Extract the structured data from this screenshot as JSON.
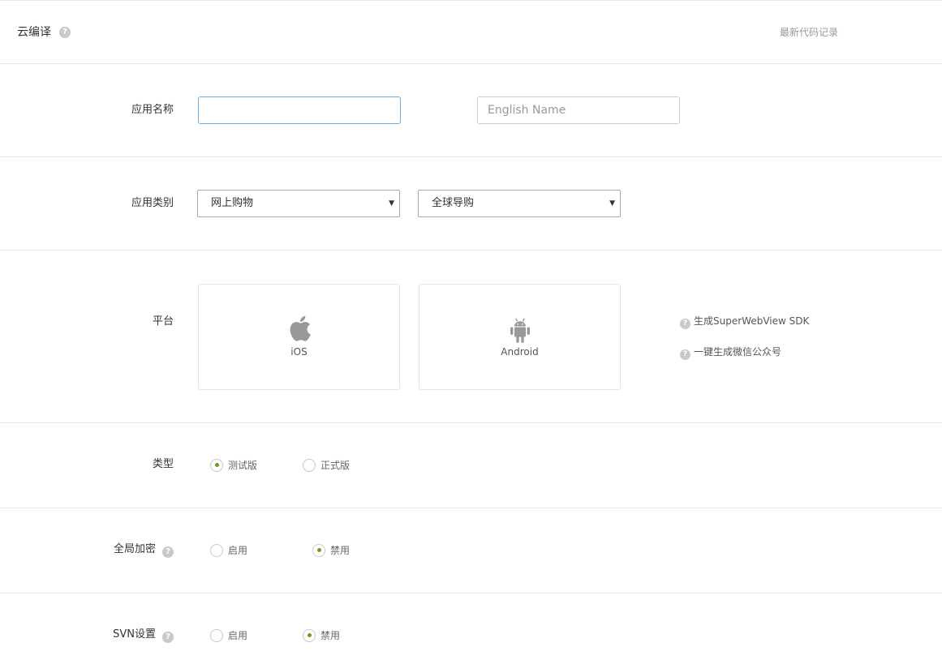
{
  "header": {
    "title": "云编译",
    "help_icon": "question-circle-icon",
    "record_link": "最新代码记录"
  },
  "app_name": {
    "label": "应用名称",
    "name_value": "",
    "english_placeholder": "English Name"
  },
  "app_category": {
    "label": "应用类别",
    "primary_selected": "网上购物",
    "secondary_selected": "全球导购"
  },
  "platform": {
    "label": "平台",
    "options": [
      {
        "label": "iOS",
        "icon": "apple-icon"
      },
      {
        "label": "Android",
        "icon": "android-icon"
      }
    ],
    "links": [
      "生成SuperWebView SDK",
      "一键生成微信公众号"
    ]
  },
  "build_type": {
    "label": "类型",
    "options": [
      "测试版",
      "正式版"
    ],
    "selected": "测试版"
  },
  "global_encryption": {
    "label": "全局加密",
    "options": [
      "启用",
      "禁用"
    ],
    "selected": "禁用"
  },
  "svn": {
    "label": "SVN设置",
    "options": [
      "启用",
      "禁用"
    ],
    "selected": "禁用"
  },
  "colors": {
    "accent": "#6a9d1e",
    "focus_border": "#66afe9",
    "divider": "#e6e6e6",
    "icon_gray": "#999999"
  }
}
